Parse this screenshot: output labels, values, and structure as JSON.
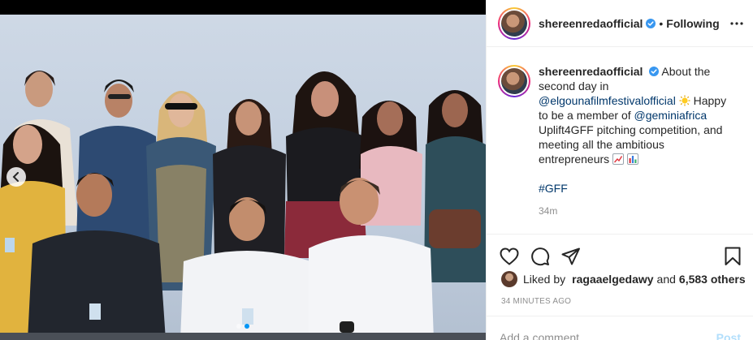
{
  "post": {
    "username": "shereenredaofficial",
    "follow_separator": "•",
    "follow_label": "Following"
  },
  "caption": {
    "username": "shereenredaofficial",
    "text_1": "About the second day in",
    "mention_1": "@elgounafilmfestivalofficial",
    "text_2": "Happy to be a member of",
    "mention_2": "@geminiafrica",
    "text_3": "Uplift4GFF pitching competition, and meeting all the ambitious entrepreneurs",
    "hashtag": "#GFF",
    "time_ago": "34m",
    "icons": [
      "sun-emoji",
      "chart-increasing-emoji",
      "bar-chart-emoji"
    ]
  },
  "actions": {
    "icons": [
      "heart-icon",
      "comment-icon",
      "share-icon",
      "bookmark-icon"
    ]
  },
  "likes": {
    "prefix": "Liked by",
    "user": "ragaaelgedawy",
    "conjunction": "and",
    "others": "6,583 others"
  },
  "posted_at": "34 MINUTES AGO",
  "comment": {
    "placeholder": "Add a comment…",
    "post_label": "Post"
  },
  "carousel": {
    "slide_count": 2,
    "active_slide": 2
  },
  "colors": {
    "verified": "#3897f0",
    "link": "#00376b",
    "muted": "#8e8e8e",
    "post_disabled": "#b2dffc"
  }
}
